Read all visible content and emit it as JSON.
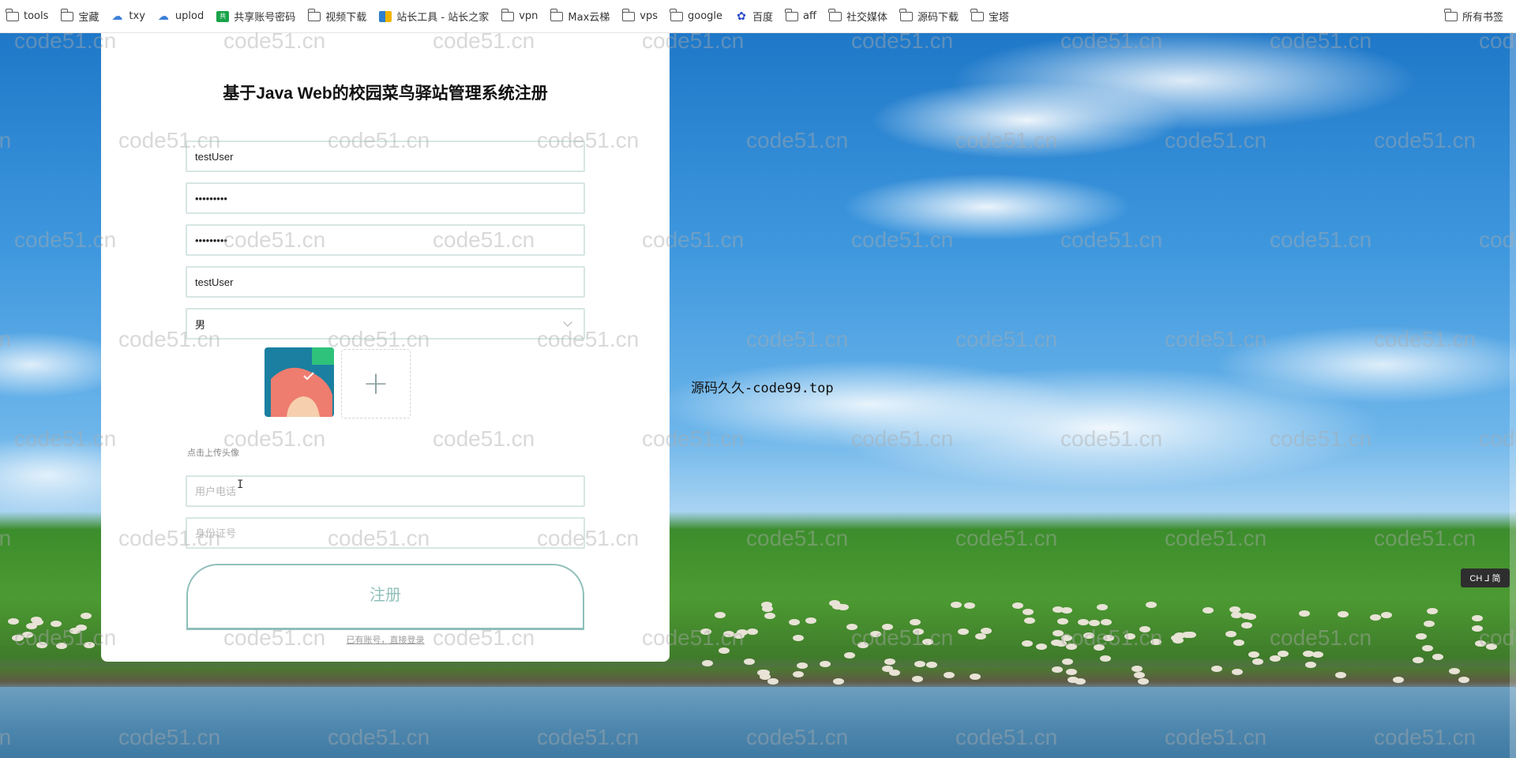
{
  "bookmarks": {
    "items": [
      {
        "label": "tools",
        "icon": "folder-icon"
      },
      {
        "label": "宝藏",
        "icon": "folder-icon"
      },
      {
        "label": "txy",
        "icon": "cloud-icon"
      },
      {
        "label": "uplod",
        "icon": "cloud-icon"
      },
      {
        "label": "共享账号密码",
        "icon": "share-icon"
      },
      {
        "label": "视频下载",
        "icon": "folder-icon"
      },
      {
        "label": "站长工具 - 站长之家",
        "icon": "tool-icon"
      },
      {
        "label": "vpn",
        "icon": "folder-icon"
      },
      {
        "label": "Max云梯",
        "icon": "folder-icon"
      },
      {
        "label": "vps",
        "icon": "folder-icon"
      },
      {
        "label": "google",
        "icon": "folder-icon"
      },
      {
        "label": "百度",
        "icon": "paw-icon"
      },
      {
        "label": "aff",
        "icon": "folder-icon"
      },
      {
        "label": "社交媒体",
        "icon": "folder-icon"
      },
      {
        "label": "源码下载",
        "icon": "folder-icon"
      },
      {
        "label": "宝塔",
        "icon": "folder-icon"
      }
    ],
    "all_bookmarks": "所有书签"
  },
  "form": {
    "title": "基于Java Web的校园菜鸟驿站管理系统注册",
    "username_value": "testUser",
    "password_value": "123456789",
    "confirm_password_value": "123456789",
    "name_value": "testUser",
    "gender_value": "男",
    "upload_hint": "点击上传头像",
    "phone_placeholder": "用户电话",
    "idcard_placeholder": "身份证号",
    "register_label": "注册",
    "login_link": "已有账号，直接登录"
  },
  "watermark_text": "code51.cn",
  "site_label": "源码久久-code99.top",
  "ime": "CH ⅃ 简",
  "colors": {
    "accent": "#8fbfba",
    "field_border": "#d6e6e4",
    "sky": "#3f98de",
    "grass": "#4c9a32"
  }
}
